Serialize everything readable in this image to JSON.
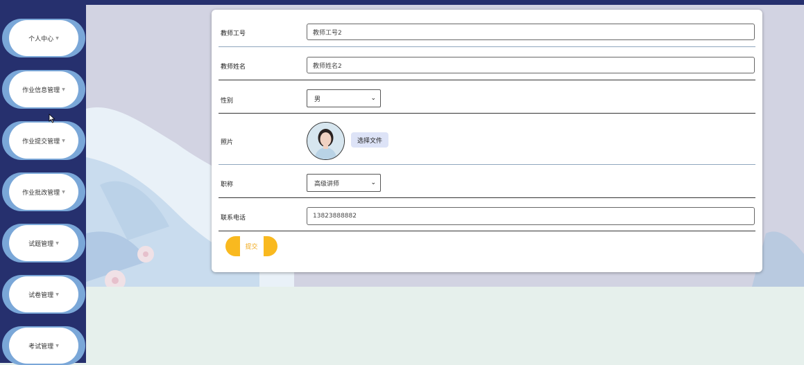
{
  "sidebar": {
    "items": [
      {
        "label": "个人中心"
      },
      {
        "label": "作业信息管理"
      },
      {
        "label": "作业提交管理"
      },
      {
        "label": "作业批改管理"
      },
      {
        "label": "试题管理"
      },
      {
        "label": "试卷管理"
      },
      {
        "label": "考试管理"
      }
    ]
  },
  "form": {
    "teacher_id": {
      "label": "教师工号",
      "value": "教师工号2"
    },
    "teacher_name": {
      "label": "教师姓名",
      "value": "教师姓名2"
    },
    "gender": {
      "label": "性别",
      "value": "男"
    },
    "photo": {
      "label": "照片",
      "button": "选择文件"
    },
    "title": {
      "label": "职称",
      "value": "高级讲师"
    },
    "phone": {
      "label": "联系电话",
      "value": "13823888882"
    },
    "submit_label": "提交"
  },
  "colors": {
    "sidebar_bg": "#26306e",
    "nav_pill": "#7aa7d8",
    "submit": "#f9b91f"
  },
  "icons": {
    "caret": "caret-down-icon",
    "select_chevron": "chevron-down-icon"
  }
}
